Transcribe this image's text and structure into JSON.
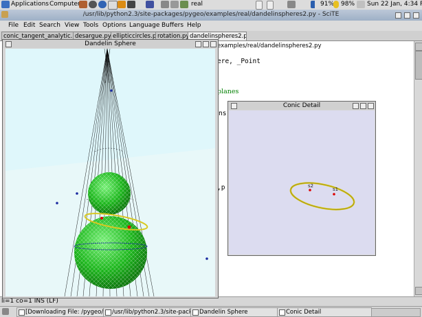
{
  "top_panel": {
    "applications": "Applications",
    "computer": "Computer",
    "real": "real",
    "battery": "91%",
    "brightness": "98%",
    "datetime": "Sun 22 Jan,  4:34 PM"
  },
  "scite": {
    "title": "/usr/lib/python2.3/site-packages/pygeo/examples/real/dandelinspheres2.py - SciTE",
    "menu": [
      "File",
      "Edit",
      "Search",
      "View",
      "Tools",
      "Options",
      "Language",
      "Buffers",
      "Help"
    ],
    "tabs": [
      "conic_tangent_analytic.py",
      "desargue.py",
      "ellipticcircles.py",
      "rotation.py",
      "dandelinspheres2.py"
    ],
    "path_fragment": "examples/real/dandelinspheres2.py",
    "code_fragments": [
      "ere, _Point",
      "planes",
      "ns",
      ",p"
    ],
    "status": "li=1 co=1 INS (LF)"
  },
  "dandelin_window": {
    "title": "Dandelin Sphere"
  },
  "conic_window": {
    "title": "Conic Detail",
    "label_s1": "s1",
    "label_s2": "s2"
  },
  "taskbar": {
    "items": [
      "[Downloading File: /pygeo/PyG",
      "/usr/lib/python2.3/site-packag",
      "Dandelin Sphere",
      "Conic Detail"
    ]
  },
  "colors": {
    "sphere_green": "#1fb81f",
    "ellipse_yellow": "#d8c820",
    "sky": "#dff7fb",
    "conic_bg": "#dcdcf0",
    "keyword_green": "#007f00"
  }
}
